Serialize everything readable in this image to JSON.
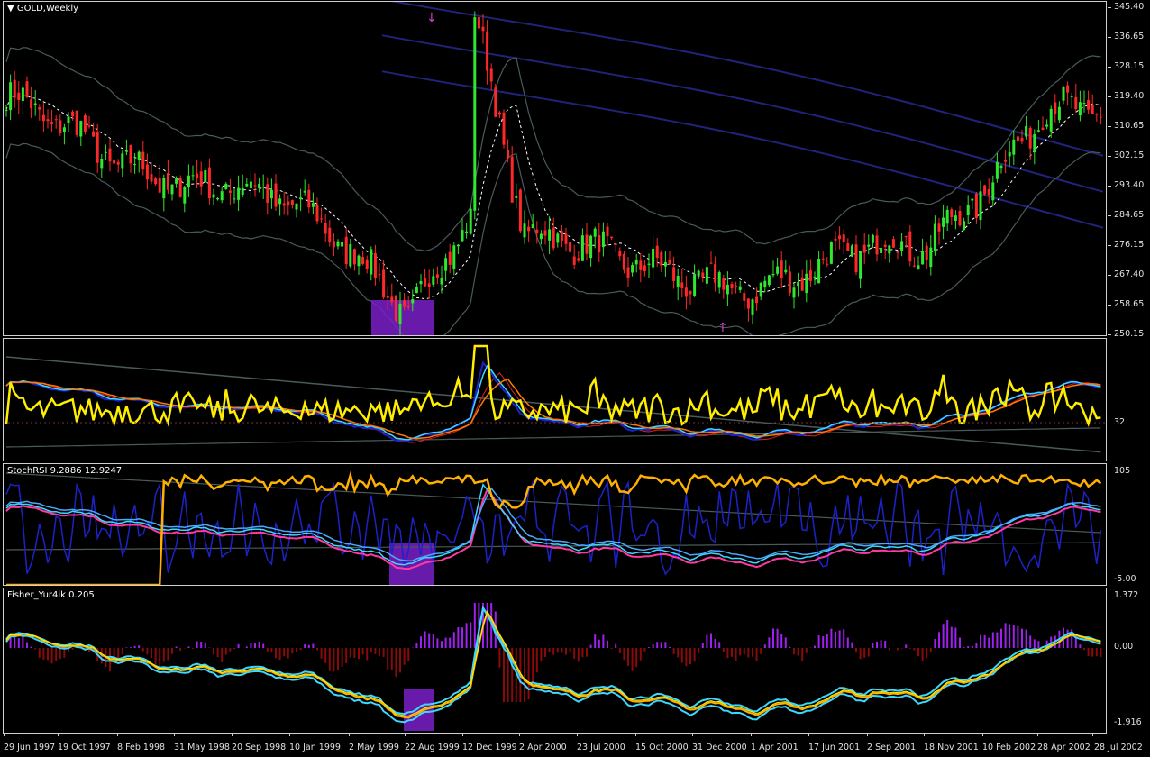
{
  "chart_title": "GOLD,Weekly",
  "price_axis": [
    "345.40",
    "336.65",
    "328.15",
    "319.40",
    "310.65",
    "302.15",
    "293.40",
    "284.65",
    "276.15",
    "267.40",
    "258.65",
    "250.15"
  ],
  "panes": {
    "rsi": {
      "scale_label": "32"
    },
    "stoch": {
      "title": "StochRSI 9.2886 12.9247",
      "scale_top": "105",
      "scale_bottom": "-5.00"
    },
    "fisher": {
      "title": "Fisher_Yur4ik 0.205",
      "scale_top": "1.372",
      "scale_mid": "0.00",
      "scale_bottom": "-1.916"
    }
  },
  "time_axis": [
    "29 Jun 1997",
    "19 Oct 1997",
    "8 Feb 1998",
    "31 May 1998",
    "20 Sep 1998",
    "10 Jan 1999",
    "2 May 1999",
    "22 Aug 1999",
    "12 Dec 1999",
    "2 Apr 2000",
    "23 Jul 2000",
    "15 Oct 2000",
    "31 Dec 2000",
    "1 Apr 2001",
    "17 Jun 2001",
    "2 Sep 2001",
    "18 Nov 2001",
    "10 Feb 2002",
    "28 Apr 2002",
    "28 Jul 2002"
  ],
  "colors": {
    "bull": "#2ee82e",
    "bear": "#ff2828",
    "yellow": "#ffee00",
    "orange": "#ffb000",
    "cyan": "#3cd8ff",
    "blue": "#1c22c8",
    "navy": "#20237a",
    "gray": "#4a5a5a",
    "pink": "#ff3aa0",
    "purple": "#7a1fc9",
    "maroon": "#8a0a0a",
    "violet": "#a020f0"
  },
  "chart_data": {
    "type": "candlestick",
    "title": "GOLD,Weekly",
    "ylim": [
      250.15,
      345.4
    ],
    "weekly_close_anchors": [
      {
        "date": "29 Jun 1997",
        "close": 320
      },
      {
        "date": "19 Oct 1997",
        "close": 312
      },
      {
        "date": "8 Feb 1998",
        "close": 300
      },
      {
        "date": "31 May 1998",
        "close": 294
      },
      {
        "date": "20 Sep 1998",
        "close": 294
      },
      {
        "date": "10 Jan 1999",
        "close": 289
      },
      {
        "date": "2 May 1999",
        "close": 275
      },
      {
        "date": "22 Aug 1999",
        "close": 256
      },
      {
        "date": "12 Dec 1999",
        "close": 284
      },
      {
        "date": "2 Apr 2000",
        "close": 280
      },
      {
        "date": "23 Jul 2000",
        "close": 277
      },
      {
        "date": "15 Oct 2000",
        "close": 271
      },
      {
        "date": "31 Dec 2000",
        "close": 266
      },
      {
        "date": "1 Apr 2001",
        "close": 263
      },
      {
        "date": "17 Jun 2001",
        "close": 270
      },
      {
        "date": "2 Sep 2001",
        "close": 277
      },
      {
        "date": "18 Nov 2001",
        "close": 276
      },
      {
        "date": "10 Feb 2002",
        "close": 293
      },
      {
        "date": "28 Apr 2002",
        "close": 310
      },
      {
        "date": "28 Jul 2002",
        "close": 305
      }
    ]
  }
}
